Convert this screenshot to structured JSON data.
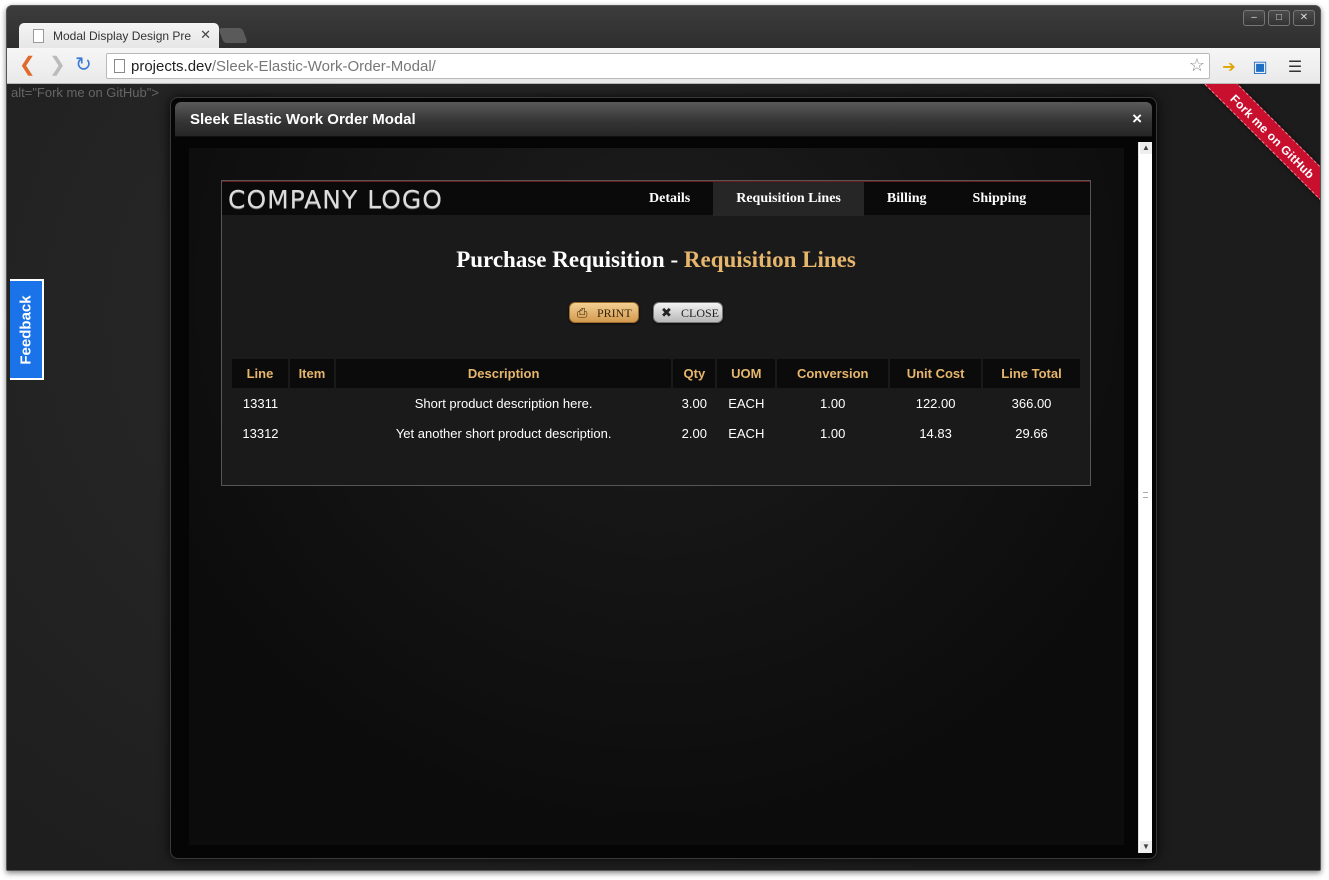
{
  "browser": {
    "tab_title": "Modal Display Design Prev",
    "url_host": "projects.dev",
    "url_path": "/Sleek-Elastic-Work-Order-Modal/",
    "window_controls": [
      "–",
      "□",
      "✕"
    ]
  },
  "page": {
    "alt_text": "alt=\"Fork me on GitHub\">",
    "feedback_label": "Feedback",
    "ribbon_label": "Fork me on GitHub"
  },
  "modal": {
    "title": "Sleek Elastic Work Order Modal",
    "close_glyph": "×",
    "logo": "COMPANY LOGO",
    "nav": [
      "Details",
      "Requisition Lines",
      "Billing",
      "Shipping"
    ],
    "active_nav": "Requisition Lines",
    "heading_main": "Purchase Requisition - ",
    "heading_accent": "Requisition Lines",
    "print_label": "PRINT",
    "close_label": "CLOSE",
    "table": {
      "columns": [
        "Line",
        "Item",
        "Description",
        "Qty",
        "UOM",
        "Conversion",
        "Unit Cost",
        "Line Total"
      ],
      "rows": [
        [
          "13311",
          "",
          "Short product description here.",
          "3.00",
          "EACH",
          "1.00",
          "122.00",
          "366.00"
        ],
        [
          "13312",
          "",
          "Yet another short product description.",
          "2.00",
          "EACH",
          "1.00",
          "14.83",
          "29.66"
        ]
      ]
    }
  },
  "colors": {
    "accent": "#e7b66d",
    "ribbon": "#c8102e",
    "feedback": "#1a73e8"
  }
}
